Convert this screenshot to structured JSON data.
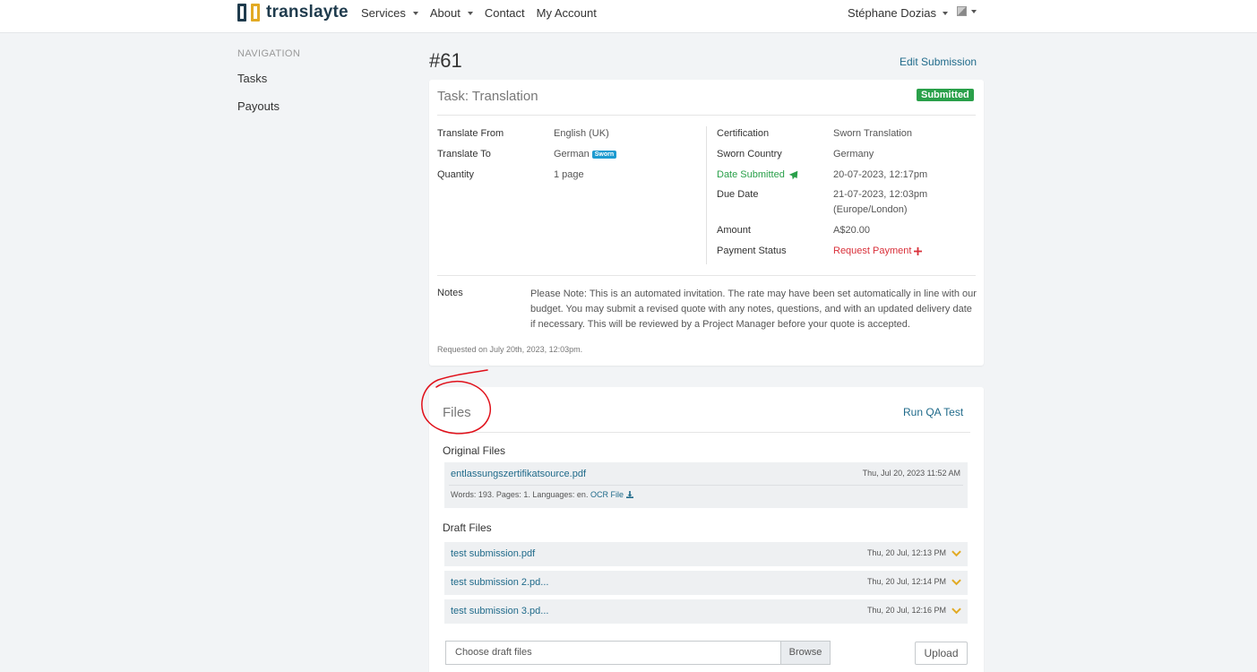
{
  "brand": {
    "name": "translayte"
  },
  "nav": {
    "items": [
      "Services",
      "About",
      "Contact",
      "My Account"
    ]
  },
  "user": {
    "name": "Stéphane Dozias"
  },
  "sidebar": {
    "heading": "NAVIGATION",
    "items": [
      "Tasks",
      "Payouts"
    ]
  },
  "task": {
    "id": "#61",
    "edit_label": "Edit Submission",
    "title": "Task: Translation",
    "status": "Submitted",
    "left_fields": [
      {
        "label": "Translate From",
        "value": "English (UK)"
      },
      {
        "label": "Translate To",
        "value": "German",
        "badge": "Sworn"
      },
      {
        "label": "Quantity",
        "value": "1 page"
      }
    ],
    "right_fields": [
      {
        "label": "Certification",
        "value": "Sworn Translation"
      },
      {
        "label": "Sworn Country",
        "value": "Germany"
      },
      {
        "label": "Date Submitted",
        "value": "20-07-2023, 12:17pm"
      },
      {
        "label": "Due Date",
        "value": "21-07-2023, 12:03pm",
        "value2": "(Europe/London)"
      },
      {
        "label": "Amount",
        "value": "A$20.00"
      },
      {
        "label": "Payment Status",
        "value": "Request Payment"
      }
    ],
    "notes_label": "Notes",
    "notes": "Please Note: This is an automated invitation. The rate may have been set automatically in line with our budget. You may submit a revised quote with any notes, questions, and with an updated delivery date if necessary. This will be reviewed by a Project Manager before your quote is accepted.",
    "requested": "Requested on July 20th, 2023, 12:03pm."
  },
  "files": {
    "title": "Files",
    "qa_label": "Run QA Test",
    "original_heading": "Original Files",
    "original": {
      "name": "entlassungszertifikatsource.pdf",
      "date": "Thu, Jul 20, 2023 11:52 AM",
      "meta": "Words: 193. Pages: 1. Languages: en.",
      "ocr_label": "OCR File"
    },
    "draft_heading": "Draft Files",
    "drafts": [
      {
        "name": "test submission.pdf",
        "date": "Thu, 20 Jul, 12:13 PM"
      },
      {
        "name": "test submission 2.pd...",
        "date": "Thu, 20 Jul, 12:14 PM"
      },
      {
        "name": "test submission 3.pd...",
        "date": "Thu, 20 Jul, 12:16 PM"
      }
    ],
    "input_placeholder": "Choose draft files",
    "browse_label": "Browse",
    "upload_label": "Upload"
  },
  "colors": {
    "accent": "#1f6a8a",
    "brand_dark": "#1f3b4d",
    "brand_gold": "#e2aa24",
    "success": "#2aa04a",
    "danger": "#d9303a",
    "annotation": "#e0101a"
  }
}
